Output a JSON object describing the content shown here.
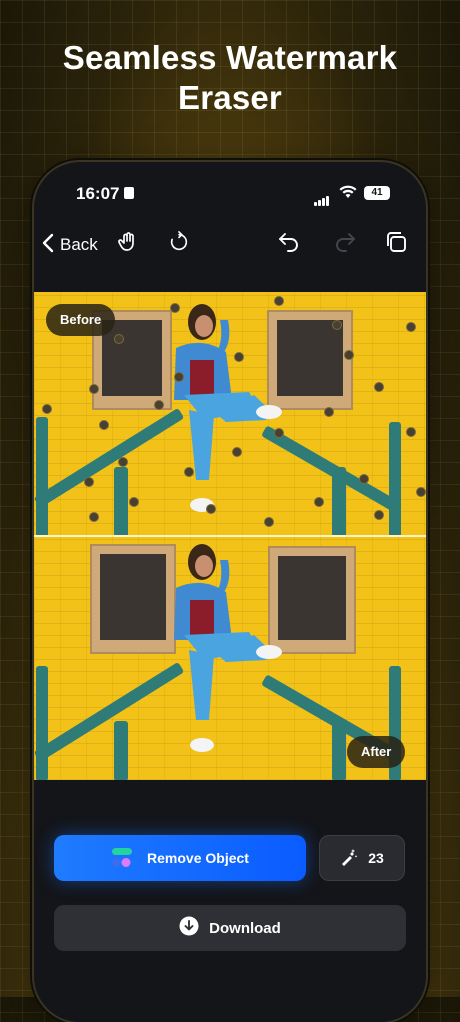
{
  "headline": {
    "line1": "Seamless Watermark",
    "line2": "Eraser"
  },
  "status_bar": {
    "time": "16:07",
    "battery": "41"
  },
  "toolbar": {
    "back_label": "Back",
    "icons": [
      "hand-icon",
      "rotate-icon",
      "undo-icon",
      "redo-icon",
      "copy-icon"
    ]
  },
  "canvas": {
    "before_label": "Before",
    "after_label": "After"
  },
  "actions": {
    "remove_label": "Remove Object",
    "credits_count": "23",
    "download_label": "Download"
  },
  "colors": {
    "accent_blue": "#1f7bff",
    "background_dark": "#141519",
    "wall_yellow": "#f2c219"
  }
}
